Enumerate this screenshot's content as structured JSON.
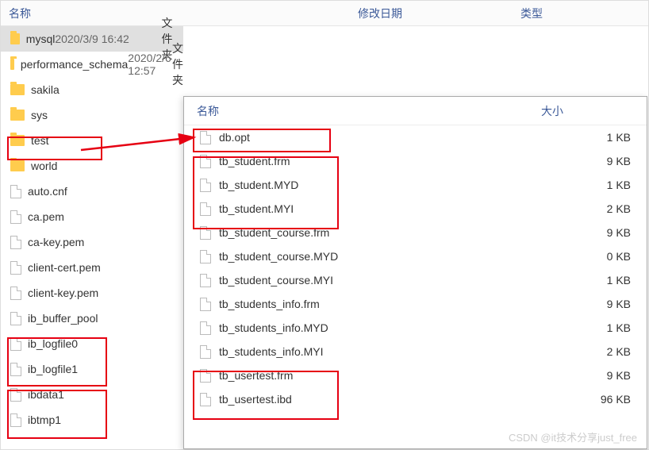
{
  "main_headers": {
    "name": "名称",
    "date": "修改日期",
    "type": "类型"
  },
  "left_rows": [
    {
      "icon": "folder",
      "name": "mysql",
      "date": "2020/3/9 16:42",
      "type": "文件夹",
      "selected": true
    },
    {
      "icon": "folder",
      "name": "performance_schema",
      "date": "2020/2/6 12:57",
      "type": "文件夹"
    },
    {
      "icon": "folder",
      "name": "sakila"
    },
    {
      "icon": "folder",
      "name": "sys"
    },
    {
      "icon": "folder",
      "name": "test"
    },
    {
      "icon": "folder",
      "name": "world"
    },
    {
      "icon": "file",
      "name": "auto.cnf"
    },
    {
      "icon": "file",
      "name": "ca.pem"
    },
    {
      "icon": "file",
      "name": "ca-key.pem"
    },
    {
      "icon": "file",
      "name": "client-cert.pem"
    },
    {
      "icon": "file",
      "name": "client-key.pem"
    },
    {
      "icon": "file",
      "name": "ib_buffer_pool"
    },
    {
      "icon": "file",
      "name": "ib_logfile0"
    },
    {
      "icon": "file",
      "name": "ib_logfile1"
    },
    {
      "icon": "file",
      "name": "ibdata1"
    },
    {
      "icon": "file",
      "name": "ibtmp1"
    }
  ],
  "right_headers": {
    "name": "名称",
    "size": "大小"
  },
  "right_rows": [
    {
      "name": "db.opt",
      "size": "1 KB"
    },
    {
      "name": "tb_student.frm",
      "size": "9 KB"
    },
    {
      "name": "tb_student.MYD",
      "size": "1 KB"
    },
    {
      "name": "tb_student.MYI",
      "size": "2 KB"
    },
    {
      "name": "tb_student_course.frm",
      "size": "9 KB"
    },
    {
      "name": "tb_student_course.MYD",
      "size": "0 KB"
    },
    {
      "name": "tb_student_course.MYI",
      "size": "1 KB"
    },
    {
      "name": "tb_students_info.frm",
      "size": "9 KB"
    },
    {
      "name": "tb_students_info.MYD",
      "size": "1 KB"
    },
    {
      "name": "tb_students_info.MYI",
      "size": "2 KB"
    },
    {
      "name": "tb_usertest.frm",
      "size": "9 KB"
    },
    {
      "name": "tb_usertest.ibd",
      "size": "96 KB"
    }
  ],
  "watermark": "CSDN @it技术分享just_free"
}
